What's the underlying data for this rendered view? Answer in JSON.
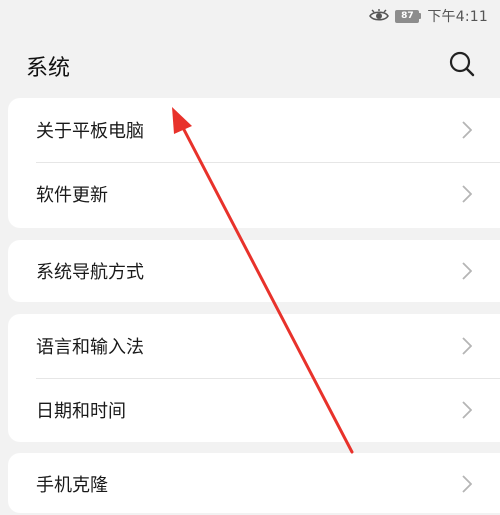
{
  "status_bar": {
    "battery_level": "87",
    "time": "下午4:11",
    "icons": [
      "eye-icon",
      "battery-icon"
    ]
  },
  "header": {
    "title": "系统",
    "search_icon": "search-icon"
  },
  "groups": [
    {
      "items": [
        {
          "label": "关于平板电脑"
        },
        {
          "label": "软件更新"
        }
      ]
    },
    {
      "items": [
        {
          "label": "系统导航方式"
        }
      ]
    },
    {
      "items": [
        {
          "label": "语言和输入法"
        },
        {
          "label": "日期和时间"
        }
      ]
    },
    {
      "items": [
        {
          "label": "手机克隆"
        }
      ]
    }
  ],
  "annotation": {
    "arrow_color": "#e8322b"
  },
  "colors": {
    "background": "#f2f2f2",
    "card": "#ffffff",
    "text": "#1a1a1a",
    "chevron": "#b5b5b5"
  }
}
